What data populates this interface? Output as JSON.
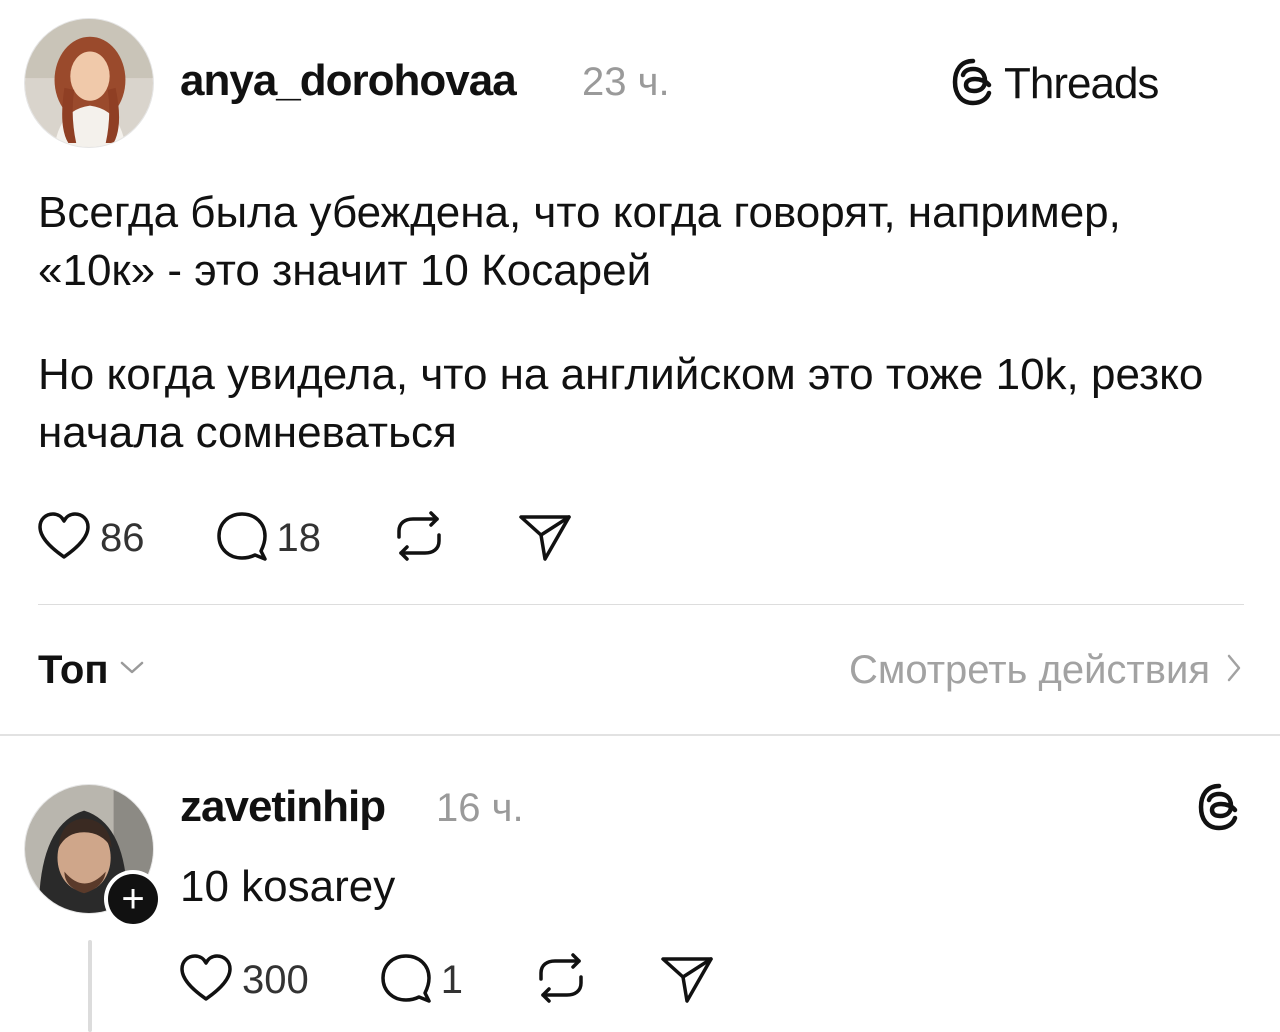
{
  "post": {
    "author": "anya_dorohovaa",
    "time": "23 ч.",
    "brand_label": "Threads",
    "paragraphs": [
      "Всегда была убеждена, что когда говорят, например, «10к» - это значит 10 Косарей",
      "Но когда увидела, что на английском это тоже 10k, резко начала сомневаться"
    ],
    "likes": "86",
    "comments": "18"
  },
  "sort": {
    "label": "Топ"
  },
  "activity": {
    "label": "Смотреть действия"
  },
  "reply": {
    "author": "zavetinhip",
    "time": "16 ч.",
    "text": "10 kosarey",
    "plus_symbol": "+",
    "likes": "300",
    "comments": "1"
  },
  "icons": {
    "like": "heart-icon",
    "comment": "comment-bubble-icon",
    "repost": "repost-icon",
    "share": "share-send-icon",
    "brand": "threads-logo-icon",
    "sort_chevron": "chevron-down-icon",
    "activity_chevron": "chevron-right-icon"
  },
  "colors": {
    "text": "#111111",
    "muted": "#9a9a9a",
    "divider": "#dddddd",
    "badge": "#111111"
  }
}
